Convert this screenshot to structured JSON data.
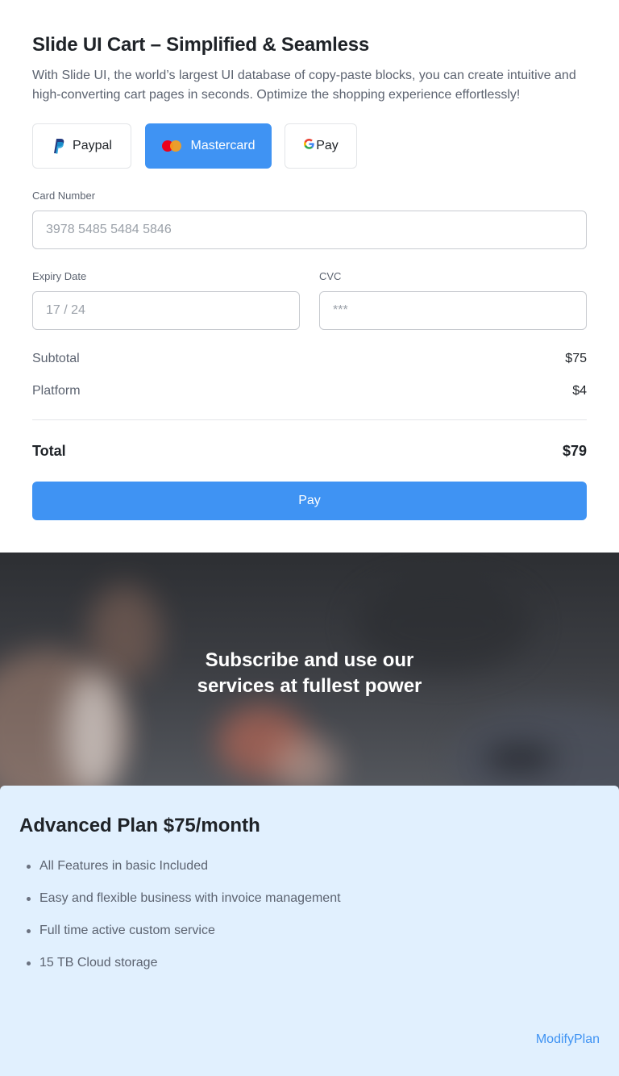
{
  "cart": {
    "title": "Slide UI Cart – Simplified & Seamless",
    "description": "With Slide UI, the world’s largest UI database of copy-paste blocks, you can create intuitive and high-converting cart pages in seconds. Optimize the shopping experience effortlessly!",
    "payment_methods": [
      {
        "label": "Paypal",
        "icon": "paypal-icon",
        "selected": false
      },
      {
        "label": "Mastercard",
        "icon": "mastercard-icon",
        "selected": true
      },
      {
        "label": "Pay",
        "icon": "google-g-icon",
        "selected": false
      }
    ],
    "card_number": {
      "label": "Card Number",
      "placeholder": "3978 5485 5484 5846"
    },
    "expiry": {
      "label": "Expiry Date",
      "placeholder": "17 / 24"
    },
    "cvc": {
      "label": "CVC",
      "placeholder": "***"
    },
    "summary": [
      {
        "label": "Subtotal",
        "amount": "$75"
      },
      {
        "label": "Platform",
        "amount": "$4"
      }
    ],
    "total": {
      "label": "Total",
      "amount": "$79"
    },
    "pay_label": "Pay",
    "accent_color": "#3f93f3"
  },
  "hero": {
    "line1": "Subscribe and use our",
    "line2": "services at fullest power"
  },
  "plan": {
    "title": "Advanced Plan $75/month",
    "features": [
      "All Features in basic Included",
      "Easy and flexible business with invoice management",
      "Full time active custom service",
      "15 TB Cloud storage"
    ],
    "modify_label": "ModifyPlan",
    "background_color": "#e1f0fe"
  }
}
